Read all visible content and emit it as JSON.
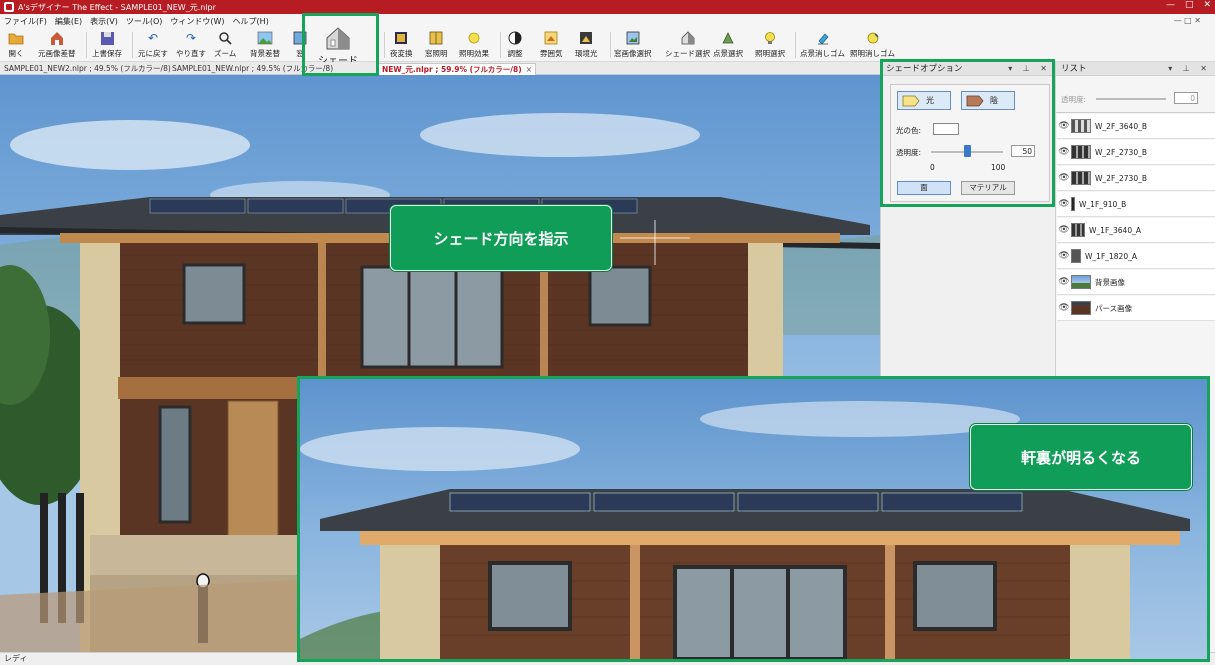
{
  "window": {
    "title": "A'sデザイナー The Effect - SAMPLE01_NEW_元.nlpr",
    "minimize": "—",
    "maximize": "□",
    "close": "✕"
  },
  "menu": {
    "items": [
      "ファイル(F)",
      "編集(E)",
      "表示(V)",
      "ツール(O)",
      "ウィンドウ(W)",
      "ヘルプ(H)"
    ],
    "mdi_controls": "— □ ✕"
  },
  "toolbar": {
    "open": "開く",
    "replace_source": "元画像差替",
    "overwrite_save": "上書保存",
    "undo": "元に戻す",
    "redo": "やり直す",
    "zoom": "ズーム",
    "bg_replace": "背景差替",
    "window_cut": "窓",
    "shade": "シェード",
    "night": "夜変換",
    "window_light": "窓照明",
    "light_effect": "照明効果",
    "adjust": "調整",
    "atmosphere": "雰囲気",
    "ambient": "環境光",
    "window_select": "窓画像選択",
    "shade_select": "シェード選択",
    "pointlight_select": "点景選択",
    "lighting_select": "照明選択",
    "pointlight_erase": "点景消しゴム",
    "lighting_erase": "照明消しゴム"
  },
  "tabs": {
    "tab1": "SAMPLE01_NEW2.nlpr ; 49.5% (フルカラー/8)",
    "tab2": "SAMPLE01_NEW.nlpr ; 49.5% (フルカラー/8)",
    "tab3": "NEW_元.nlpr ; 59.9% (フルカラー/8)",
    "tab3_close": "×"
  },
  "shade_panel": {
    "title": "シェードオプション",
    "controls": "▾ ⊥ ✕",
    "light": "光",
    "shadow": "陰",
    "light_color": "光の色:",
    "opacity_label": "透明度:",
    "opacity_value": "50",
    "opacity": 0.5,
    "min": "0",
    "max": "100",
    "face": "面",
    "material": "マテリアル"
  },
  "list_panel": {
    "title": "リスト",
    "controls": "▾ ⊥ ✕",
    "opacity_label": "透明度:",
    "opacity_value": "0",
    "items": [
      {
        "label": "W_2F_3640_B"
      },
      {
        "label": "W_2F_2730_B"
      },
      {
        "label": "W_2F_2730_B"
      },
      {
        "label": "W_1F_910_B"
      },
      {
        "label": "W_1F_3640_A"
      },
      {
        "label": "W_1F_1820_A"
      },
      {
        "label": "背景画像"
      },
      {
        "label": "パース画像"
      }
    ]
  },
  "callouts": {
    "direction": "シェード方向を指示",
    "brighter": "軒裏が明るくなる"
  },
  "status": {
    "text": "レディ"
  },
  "colors": {
    "title_bar": "#b71c23",
    "highlight": "#16a35a",
    "callout": "#0f9d58"
  }
}
